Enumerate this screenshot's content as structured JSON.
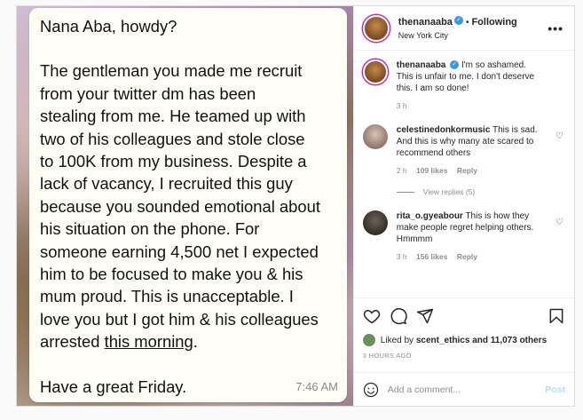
{
  "message": {
    "greeting": "Nana Aba, howdy?",
    "lines": [
      "The gentleman you made me recruit",
      "from your twitter dm has been",
      "stealing from me. He teamed up with",
      "two of his colleagues and stole close",
      "to 100K from my business. Despite a",
      "lack of vacancy, I recruited this guy",
      "because you sounded emotional about",
      "his situation on the phone. For",
      "someone earning 4,500 net I expected",
      "him to be focused to make you & his",
      "mum proud. This is unacceptable. I",
      "love you but I got him & his colleagues"
    ],
    "last_line_prefix": "arrested ",
    "last_line_underlined": "this morning",
    "last_line_suffix": ".",
    "signoff": "Have a great Friday.",
    "time": "7:46 AM"
  },
  "header": {
    "username": "thenanaaba",
    "verified_glyph": "✓",
    "dot": "•",
    "follow_label": "Following",
    "location": "New York City",
    "more": "•••"
  },
  "caption": {
    "username": "thenanaaba",
    "text": "I'm so ashamed. This is unfair to me. I don't deserve this. I am so done!",
    "age": "3 h"
  },
  "comments": [
    {
      "username": "celestinedonkormusic",
      "text": "This is sad. And this is why many ate scared to recommend others",
      "age": "2 h",
      "likes": "109 likes",
      "reply": "Reply",
      "view_replies": "View replies (5)"
    },
    {
      "username": "rita_o.gyeabour",
      "text": "This is how they make people regret helping others. Hmmmm",
      "age": "3 h",
      "likes": "156 likes",
      "reply": "Reply"
    }
  ],
  "likes": {
    "liked_by_prefix": "Liked by ",
    "liked_by_user": "scent_ethics",
    "liked_by_suffix": " and 11,073 others",
    "time_ago": "3 HOURS AGO"
  },
  "add_comment": {
    "placeholder": "Add a comment...",
    "post_label": "Post"
  },
  "icons": [
    "heart-icon",
    "comment-icon",
    "share-icon",
    "bookmark-icon",
    "emoji-icon"
  ],
  "colors": {
    "accent": "#3897f0",
    "post_disabled": "#b2dffc",
    "muted": "#8e8e8e"
  }
}
